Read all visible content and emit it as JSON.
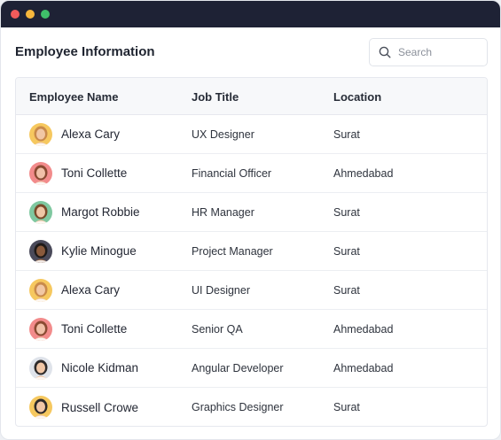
{
  "page": {
    "title": "Employee Information"
  },
  "search": {
    "placeholder": "Search",
    "value": ""
  },
  "table": {
    "columns": [
      "Employee Name",
      "Job Title",
      "Location"
    ],
    "rows": [
      {
        "name": "Alexa Cary",
        "job": "UX Designer",
        "location": "Surat",
        "avatar_bg": "#f6c85f",
        "skin": "#f1c7a4",
        "hair": "#c98a4b"
      },
      {
        "name": "Toni Collette",
        "job": "Financial Officer",
        "location": "Ahmedabad",
        "avatar_bg": "#f28b8b",
        "skin": "#f0c0a8",
        "hair": "#8a4a32"
      },
      {
        "name": "Margot Robbie",
        "job": "HR Manager",
        "location": "Surat",
        "avatar_bg": "#7fc8a0",
        "skin": "#f0c6a6",
        "hair": "#7a4a2a"
      },
      {
        "name": "Kylie Minogue",
        "job": "Project Manager",
        "location": "Surat",
        "avatar_bg": "#4a4a5a",
        "skin": "#8a5a3c",
        "hair": "#1f1a18"
      },
      {
        "name": "Alexa Cary",
        "job": "UI Designer",
        "location": "Surat",
        "avatar_bg": "#f6c85f",
        "skin": "#f1c7a4",
        "hair": "#c98a4b"
      },
      {
        "name": "Toni Collette",
        "job": "Senior QA",
        "location": "Ahmedabad",
        "avatar_bg": "#f28b8b",
        "skin": "#f0c0a8",
        "hair": "#8a4a32"
      },
      {
        "name": "Nicole Kidman",
        "job": "Angular Developer",
        "location": "Ahmedabad",
        "avatar_bg": "#dfe3ea",
        "skin": "#f0c6a6",
        "hair": "#2e2a2a"
      },
      {
        "name": "Russell Crowe",
        "job": "Graphics Designer",
        "location": "Surat",
        "avatar_bg": "#f6c85f",
        "skin": "#f0c6a6",
        "hair": "#2e2a2a"
      }
    ]
  },
  "colors": {
    "titlebar": "#1e2235",
    "accent_text": "#1f2430"
  }
}
